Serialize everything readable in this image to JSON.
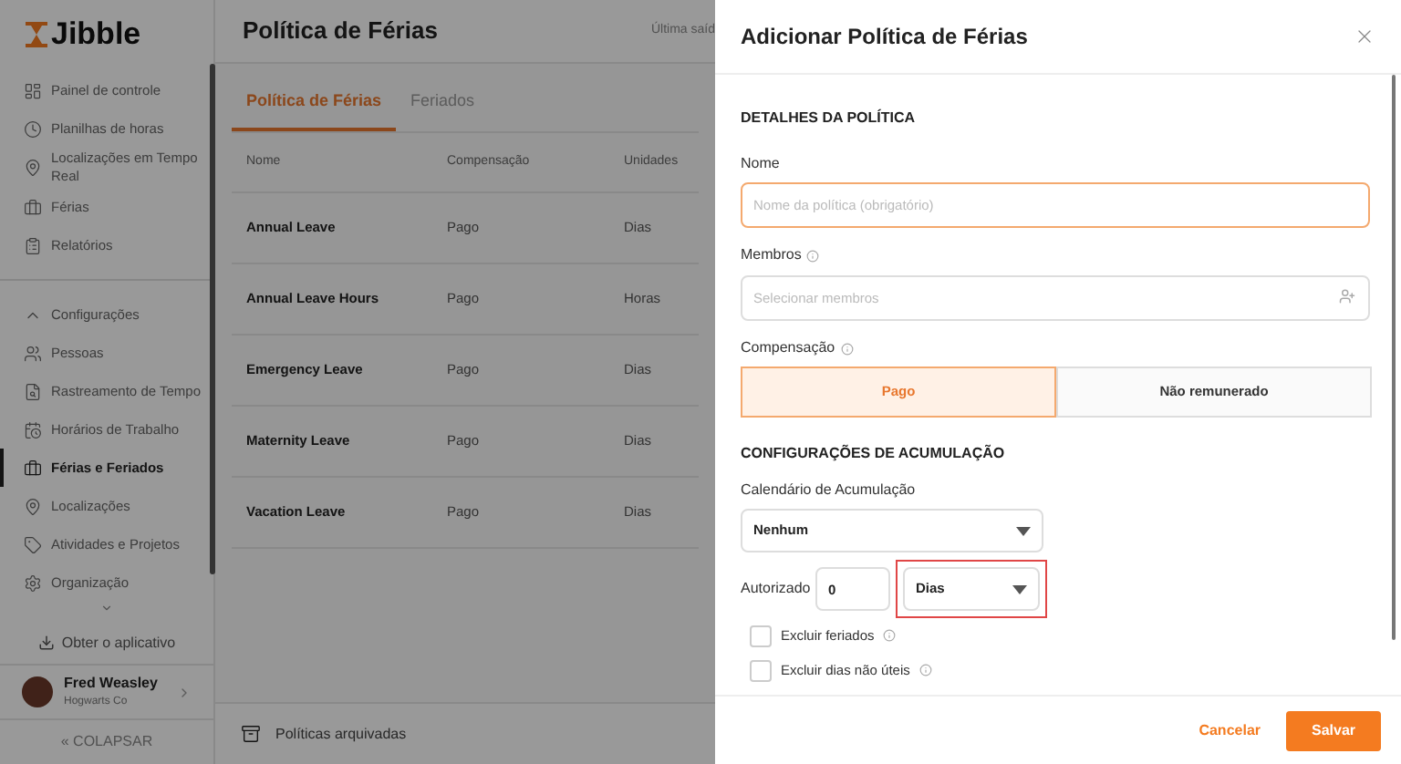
{
  "sidebar": {
    "logo": "Jibble",
    "items": [
      {
        "kind": "link",
        "label": "Painel de controle",
        "selected": false
      },
      {
        "kind": "link",
        "label": "Planilhas de horas",
        "selected": false
      },
      {
        "kind": "link",
        "label": "Localizações em Tempo Real",
        "selected": false
      },
      {
        "kind": "link",
        "label": "Férias",
        "selected": false
      },
      {
        "kind": "link",
        "label": "Relatórios",
        "selected": false
      },
      {
        "kind": "group",
        "label": "Configurações",
        "expanded": true,
        "selected": false
      },
      {
        "kind": "link",
        "label": "Pessoas",
        "selected": false
      },
      {
        "kind": "link",
        "label": "Rastreamento de Tempo",
        "selected": false
      },
      {
        "kind": "link",
        "label": "Horários de Trabalho",
        "selected": false
      },
      {
        "kind": "link",
        "label": "Férias e Feriados",
        "selected": true
      },
      {
        "kind": "link",
        "label": "Localizações",
        "selected": false
      },
      {
        "kind": "link",
        "label": "Atividades e Projetos",
        "selected": false
      },
      {
        "kind": "link",
        "label": "Organização",
        "selected": false
      }
    ],
    "get_app": "Obter o aplicativo",
    "user": {
      "name": "Fred Weasley",
      "org": "Hogwarts Co"
    },
    "collapse": "« COLAPSAR"
  },
  "main": {
    "title": "Política de Férias",
    "last_out": "Última saíd",
    "tabs": [
      {
        "label": "Política de Férias",
        "selected": true
      },
      {
        "label": "Feriados",
        "selected": false
      }
    ],
    "table": {
      "columns": [
        "Nome",
        "Compensação",
        "Unidades"
      ],
      "rows": [
        [
          "Annual Leave",
          "Pago",
          "Dias"
        ],
        [
          "Annual Leave Hours",
          "Pago",
          "Horas"
        ],
        [
          "Emergency Leave",
          "Pago",
          "Dias"
        ],
        [
          "Maternity Leave",
          "Pago",
          "Dias"
        ],
        [
          "Vacation Leave",
          "Pago",
          "Dias"
        ]
      ]
    },
    "archived": "Políticas arquivadas"
  },
  "panel": {
    "title": "Adicionar Política de Férias",
    "details_heading": "DETALHES DA POLÍTICA",
    "name_label": "Nome",
    "name_placeholder": "Nome da política (obrigatório)",
    "members_label": "Membros",
    "members_placeholder": "Selecionar membros",
    "compensation_label": "Compensação",
    "compensation_options": [
      {
        "label": "Pago",
        "selected": true
      },
      {
        "label": "Não remunerado",
        "selected": false
      }
    ],
    "accrual_heading": "CONFIGURAÇÕES DE ACUMULAÇÃO",
    "calendar_label": "Calendário de Acumulação",
    "calendar_value": "Nenhum",
    "authorized_label": "Autorizado",
    "authorized_value": "0",
    "unit_value": "Dias",
    "unit_highlighted": true,
    "checkboxes": [
      {
        "label": "Excluir feriados",
        "checked": false
      },
      {
        "label": "Excluir dias não úteis",
        "checked": false
      }
    ],
    "cancel": "Cancelar",
    "save": "Salvar"
  }
}
